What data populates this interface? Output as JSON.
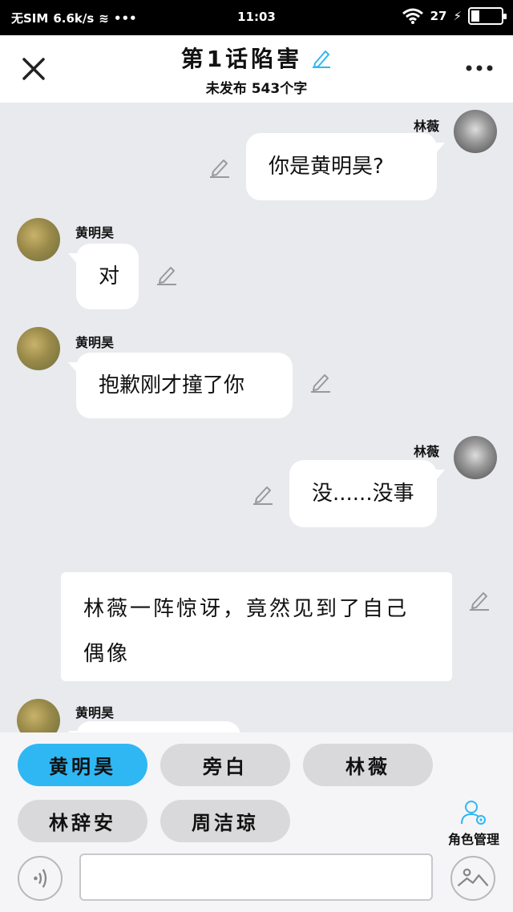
{
  "status_bar": {
    "carrier": "无SIM",
    "speed": "6.6k/s",
    "time": "11:03",
    "battery_text": "27",
    "battery_level": 0.27
  },
  "header": {
    "title": "第1话陷害",
    "subtitle": "未发布 543个字"
  },
  "messages": [
    {
      "speaker": "林薇",
      "text": "你是黄明昊?",
      "side": "right"
    },
    {
      "speaker": "黄明昊",
      "text": "对",
      "side": "left"
    },
    {
      "speaker": "黄明昊",
      "text": "抱歉刚才撞了你",
      "side": "left"
    },
    {
      "speaker": "林薇",
      "text": "没......没事",
      "side": "right"
    },
    {
      "narration": true,
      "line1": "林薇一阵惊讶，竟然见到了自己",
      "line2": "偶像"
    },
    {
      "speaker": "黄明昊",
      "text": "",
      "side": "left"
    }
  ],
  "roles": [
    {
      "label": "黄明昊",
      "active": true
    },
    {
      "label": "旁白",
      "active": false
    },
    {
      "label": "林薇",
      "active": false
    },
    {
      "label": "林辞安",
      "active": false
    },
    {
      "label": "周洁琼",
      "active": false
    }
  ],
  "role_manage_label": "角色管理",
  "input": {
    "value": "",
    "placeholder": ""
  },
  "colors": {
    "accent": "#2fb7f4",
    "background": "#e9eaee",
    "bubble": "#ffffff"
  },
  "icons": [
    "close-icon",
    "edit-icon",
    "more-icon",
    "user-gear-icon",
    "voice-icon",
    "image-icon",
    "wifi-icon"
  ]
}
